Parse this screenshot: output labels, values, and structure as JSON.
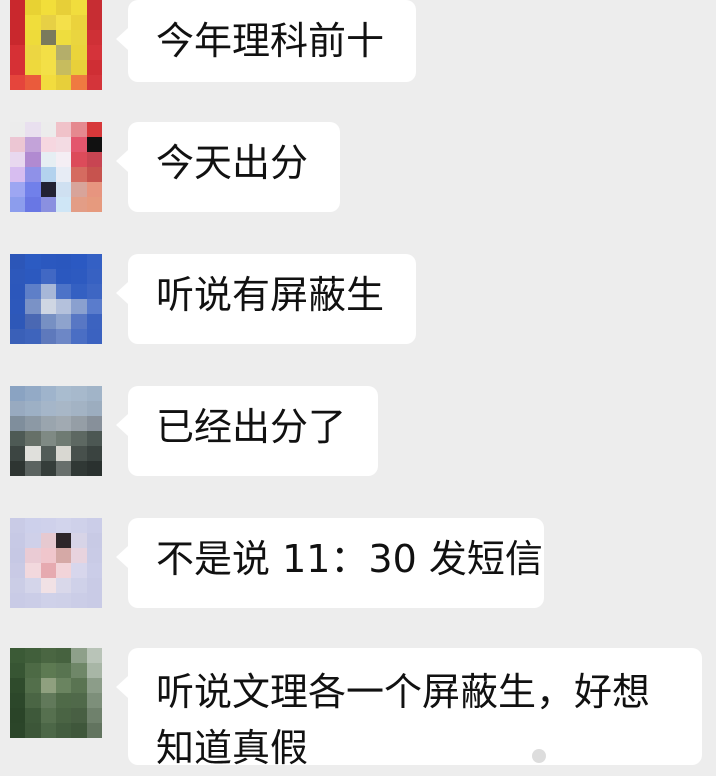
{
  "chat": {
    "messages": [
      {
        "text": "今年理科前十"
      },
      {
        "text": "今天出分"
      },
      {
        "text": "听说有屏蔽生"
      },
      {
        "text": "已经出分了"
      },
      {
        "text": "不是说 11：30 发短信"
      },
      {
        "text": "听说文理各一个屏蔽生，好想知道真假"
      }
    ]
  },
  "colors": {
    "background": "#ededed",
    "bubble": "#ffffff",
    "text": "#111111"
  }
}
